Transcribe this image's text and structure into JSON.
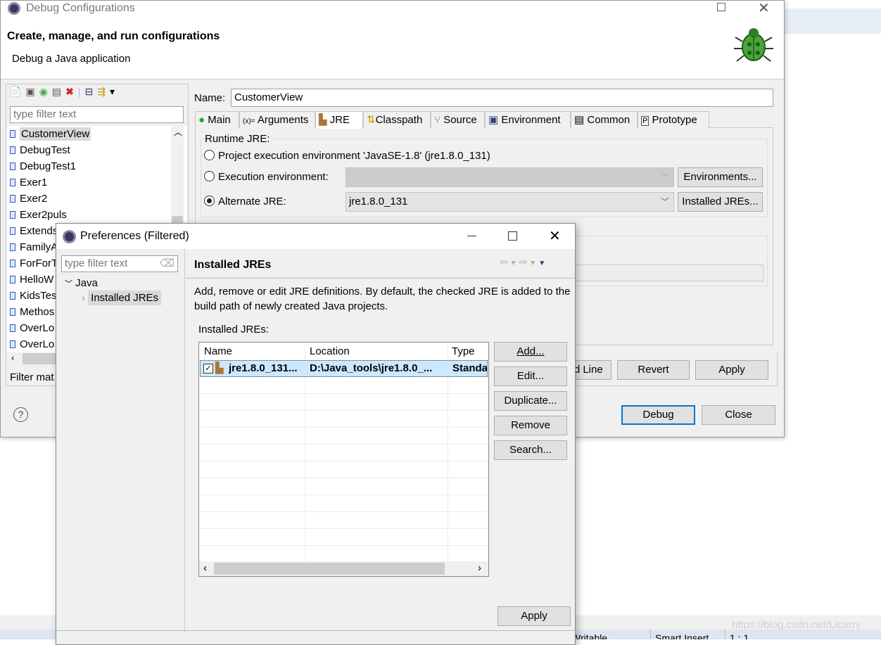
{
  "debug_dialog": {
    "title": "Debug Configurations",
    "header_title": "Create, manage, and run configurations",
    "header_subtitle": "Debug a Java application",
    "filter_placeholder": "type filter text",
    "configs": [
      "CustomerView",
      "DebugTest",
      "DebugTest1",
      "Exer1",
      "Exer2",
      "Exer2puls",
      "Extends",
      "FamilyA",
      "ForForT",
      "HelloW",
      "KidsTes",
      "Methos",
      "OverLo",
      "OverLo"
    ],
    "selected_config": "CustomerView",
    "filter_status": "Filter mat",
    "name_label": "Name:",
    "name_value": "CustomerView",
    "tabs": [
      "Main",
      "Arguments",
      "JRE",
      "Classpath",
      "Source",
      "Environment",
      "Common",
      "Prototype"
    ],
    "active_tab": "JRE",
    "runtime_group": "Runtime JRE:",
    "radio_project": "Project execution environment 'JavaSE-1.8' (jre1.8.0_131)",
    "radio_exec": "Execution environment:",
    "radio_alt": "Alternate JRE:",
    "alt_jre_value": "jre1.8.0_131",
    "environments_button": "Environments...",
    "installed_jres_button": "Installed JREs...",
    "cmdline_button": "Show Command Line",
    "revert_button": "Revert",
    "apply_button": "Apply",
    "debug_button": "Debug",
    "close_button": "Close"
  },
  "prefs_dialog": {
    "title": "Preferences (Filtered)",
    "filter_placeholder": "type filter text",
    "tree": {
      "root": "Java",
      "child": "Installed JREs"
    },
    "page_title": "Installed JREs",
    "description": "Add, remove or edit JRE definitions. By default, the checked JRE is added to the build path of newly created Java projects.",
    "table_label": "Installed JREs:",
    "columns": [
      "Name",
      "Location",
      "Type"
    ],
    "rows": [
      {
        "name": "jre1.8.0_131...",
        "location": "D:\\Java_tools\\jre1.8.0_...",
        "type": "Standa",
        "checked": true
      }
    ],
    "buttons": [
      "Add...",
      "Edit...",
      "Duplicate...",
      "Remove",
      "Search..."
    ],
    "apply_button": "Apply"
  },
  "status_bar": {
    "writable": "Writable",
    "insert_mode": "Smart Insert",
    "position": "1 : 1"
  },
  "watermark": "https://blog.csdn.net/Licarry",
  "colors": {
    "accent": "#0078d7",
    "selection": "#cce8ff",
    "dialog_bg": "#f0f0f0"
  }
}
